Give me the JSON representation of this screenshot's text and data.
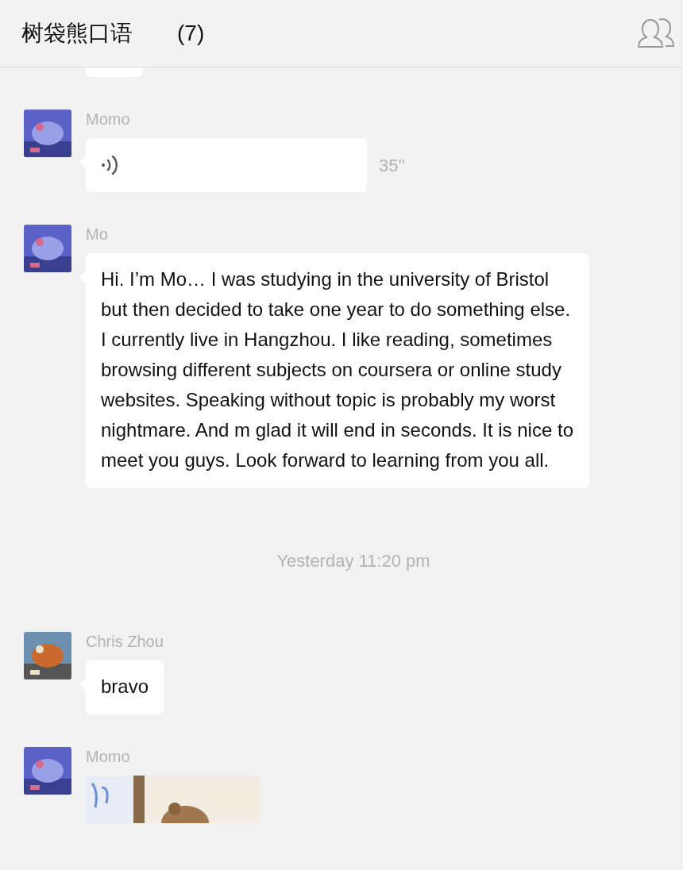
{
  "header": {
    "title": "树袋熊口语",
    "count": "(7)"
  },
  "messages": [
    {
      "kind": "partial"
    },
    {
      "kind": "voice",
      "sender": "Momo",
      "duration": "35''"
    },
    {
      "kind": "text",
      "sender": "Mo",
      "text": "Hi. I’m Mo… I was studying in the university of Bristol but then decided to take one year to do something else. I currently live in Hangzhou. I like reading, sometimes browsing different subjects on coursera or online study websites. Speaking without topic is probably my worst nightmare. And m glad it will end in seconds. It is nice to meet you guys. Look forward to learning from you all."
    },
    {
      "kind": "time",
      "text": "Yesterday 11:20 pm"
    },
    {
      "kind": "text",
      "sender": "Chris Zhou",
      "text": "bravo"
    },
    {
      "sender": "Momo"
    }
  ]
}
